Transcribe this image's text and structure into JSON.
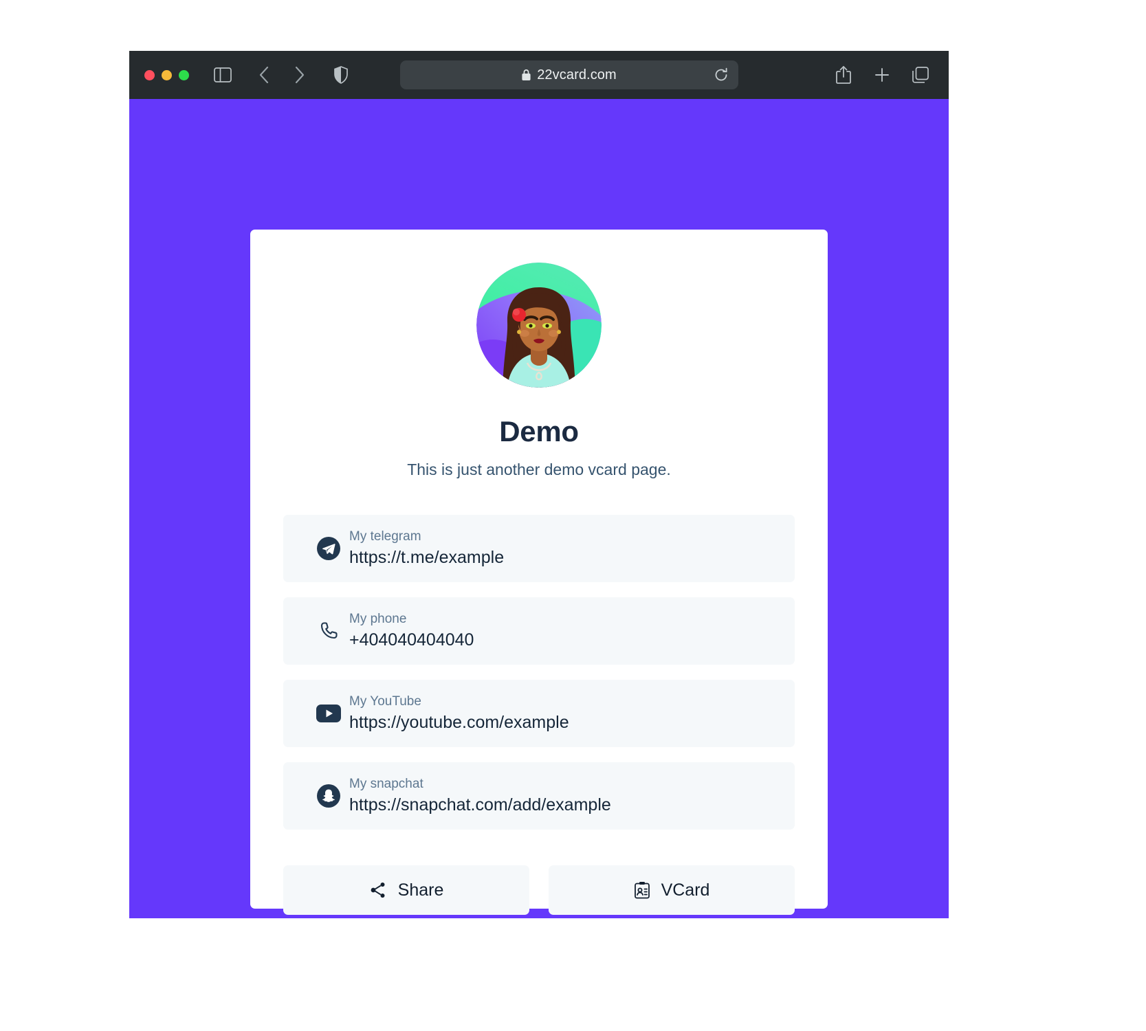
{
  "browser": {
    "traffic_lights": [
      "close",
      "minimize",
      "zoom"
    ],
    "sidebar_toggle_label": "Show sidebar",
    "back_label": "Back",
    "forward_label": "Forward",
    "shield_label": "Privacy report",
    "url": "22vcard.com",
    "lock_label": "Secure connection",
    "reload_label": "Reload",
    "share_label": "Share",
    "new_tab_label": "New tab",
    "tabs_label": "Show tab overview",
    "colors": {
      "toolbar_bg": "#262b2e",
      "urlbar_bg": "#3b4145",
      "page_bg": "#6538fb"
    }
  },
  "profile": {
    "avatar_alt": "Illustrated portrait avatar",
    "name": "Demo",
    "bio": "This is just another demo vcard page."
  },
  "links": [
    {
      "icon": "telegram-icon",
      "label": "My telegram",
      "value": "https://t.me/example"
    },
    {
      "icon": "phone-icon",
      "label": "My phone",
      "value": "+404040404040"
    },
    {
      "icon": "youtube-icon",
      "label": "My YouTube",
      "value": "https://youtube.com/example"
    },
    {
      "icon": "snapchat-icon",
      "label": "My snapchat",
      "value": "https://snapchat.com/add/example"
    }
  ],
  "actions": {
    "share": {
      "label": "Share",
      "icon": "share-nodes-icon"
    },
    "vcard": {
      "label": "VCard",
      "icon": "contact-card-icon"
    }
  }
}
